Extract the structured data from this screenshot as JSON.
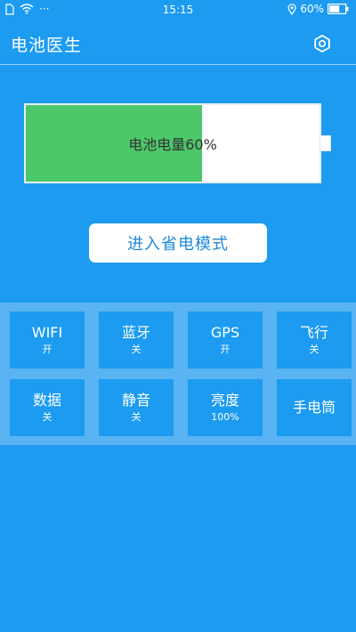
{
  "status_bar": {
    "time": "15:15",
    "battery_percent": "60%",
    "dots": "···"
  },
  "header": {
    "title": "电池医生"
  },
  "battery": {
    "level_fraction": 0.6,
    "label": "电池电量60%",
    "fill_color": "#4cc86a"
  },
  "save_mode_button": {
    "label": "进入省电模式"
  },
  "toggles": [
    {
      "label": "WIFI",
      "status": "开"
    },
    {
      "label": "蓝牙",
      "status": "关"
    },
    {
      "label": "GPS",
      "status": "开"
    },
    {
      "label": "飞行",
      "status": "关"
    },
    {
      "label": "数据",
      "status": "关"
    },
    {
      "label": "静音",
      "status": "关"
    },
    {
      "label": "亮度",
      "status": "100%"
    },
    {
      "label": "手电筒",
      "status": ""
    }
  ],
  "icons": {
    "status_left": [
      "sim-icon",
      "wifi-icon"
    ],
    "status_right": [
      "location-icon",
      "battery-icon"
    ],
    "settings": "gear-icon"
  },
  "colors": {
    "background": "#1c9bf0",
    "panel": "#5ab3f2",
    "battery_fill": "#4cc86a",
    "button_text": "#1e88d8"
  }
}
